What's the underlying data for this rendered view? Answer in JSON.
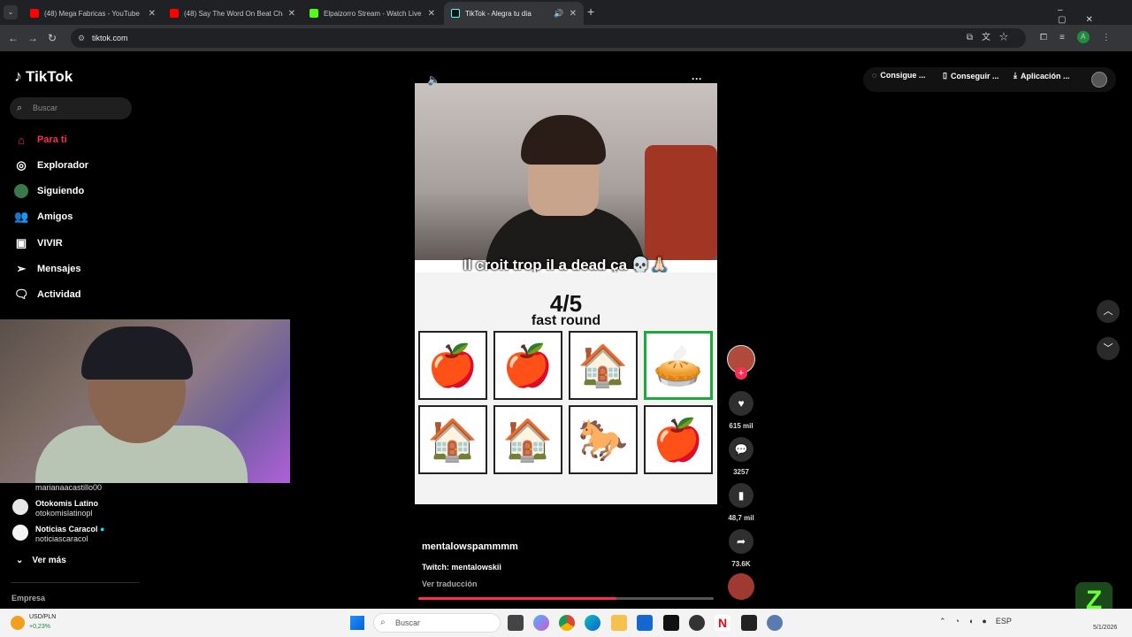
{
  "browser": {
    "tabs": [
      {
        "title": "(48) Mega Fabricas - YouTube",
        "icon": "youtube-icon"
      },
      {
        "title": "(48) Say The Word On Beat Cha",
        "icon": "youtube-icon"
      },
      {
        "title": "Elpaizorro Stream - Watch Live",
        "icon": "kick-icon"
      },
      {
        "title": "TikTok - Alegra tu día",
        "icon": "tiktok-icon"
      }
    ],
    "url": "tiktok.com",
    "new_tab": "+"
  },
  "tiktok": {
    "logo": "TikTok",
    "search_placeholder": "Buscar",
    "nav": [
      {
        "label": "Para ti",
        "icon": "home-icon"
      },
      {
        "label": "Explorador",
        "icon": "compass-icon"
      },
      {
        "label": "Siguiendo",
        "icon": "following-icon"
      },
      {
        "label": "Amigos",
        "icon": "friends-icon"
      },
      {
        "label": "VIVIR",
        "icon": "live-icon"
      },
      {
        "label": "Mensajes",
        "icon": "messages-icon"
      },
      {
        "label": "Actividad",
        "icon": "activity-icon"
      }
    ],
    "following_accounts": [
      {
        "name": "",
        "handle": "marianaacastillo00"
      },
      {
        "name": "Otokomis Latino",
        "handle": "otokomislatinopl"
      },
      {
        "name": "Noticias Caracol",
        "handle": "noticiascaracol"
      }
    ],
    "see_more": "Ver más",
    "company": "Empresa",
    "top_actions": [
      {
        "label": "Consigue ...",
        "icon": "coin-icon"
      },
      {
        "label": "Conseguir ...",
        "icon": "phone-icon"
      },
      {
        "label": "Aplicación ...",
        "icon": "download-icon"
      }
    ]
  },
  "video": {
    "caption": "Il croit trop il a dead ça 💀🙏🏻",
    "score": "4/5",
    "round": "fast round",
    "grid": [
      "🍎",
      "🍎",
      "🏠",
      "🥧",
      "🏠",
      "🏠",
      "🐎",
      "🍎"
    ],
    "highlighted_index": 3,
    "username": "mentalowspammmm",
    "description": "Twitch: mentalowskii",
    "translate": "Ver traducción",
    "progress": 0.67,
    "more": "···"
  },
  "actions": {
    "likes": "615 mil",
    "comments": "3257",
    "saves": "48,7 mil",
    "shares": "73.6K"
  },
  "taskbar": {
    "ticker_label": "USD/PLN",
    "ticker_change": "+0,23%",
    "search_placeholder": "Buscar",
    "lang": "ESP",
    "date": "5/1/2026"
  }
}
